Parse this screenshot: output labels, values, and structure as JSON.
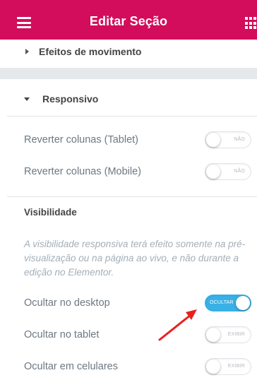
{
  "header": {
    "title": "Editar Seção"
  },
  "sections": {
    "efeitos_label": "Efeitos de movimento",
    "responsivo_label": "Responsivo"
  },
  "controls": {
    "reverse_tablet": {
      "label": "Reverter colunas (Tablet)",
      "toggle_text": "NÃO",
      "on": false
    },
    "reverse_mobile": {
      "label": "Reverter colunas (Mobile)",
      "toggle_text": "NÃO",
      "on": false
    }
  },
  "visibility": {
    "heading": "Visibilidade",
    "description": "A visibilidade responsiva terá efeito somente na pré-visualização ou na página ao vivo, e não durante a edição no Elementor.",
    "hide_desktop": {
      "label": "Ocultar no desktop",
      "toggle_text": "OCULTAR",
      "on": true
    },
    "hide_tablet": {
      "label": "Ocultar no tablet",
      "toggle_text": "EXIBIR",
      "on": false
    },
    "hide_mobile": {
      "label": "Ocultar em celulares",
      "toggle_text": "EXIBIR",
      "on": false
    }
  },
  "colors": {
    "header_bg": "#d30c5c",
    "toggle_on": "#39b0e6",
    "annotation_arrow": "#e8211f"
  }
}
